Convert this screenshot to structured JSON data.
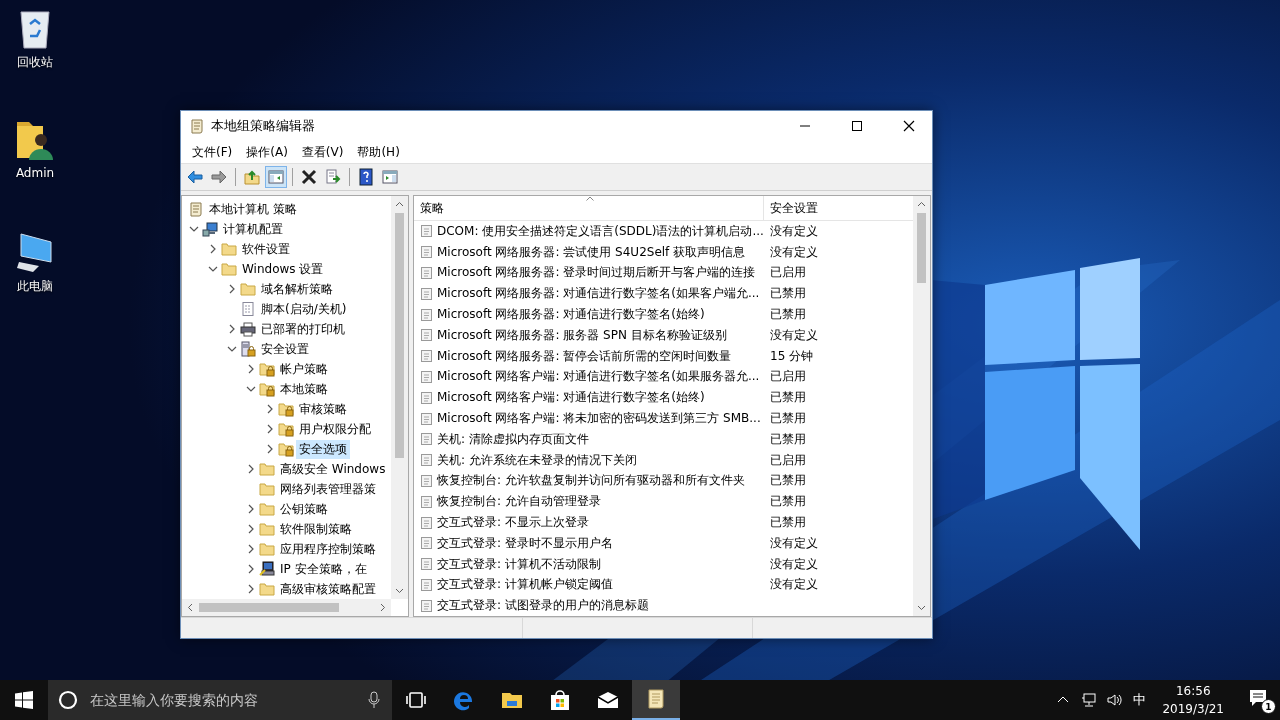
{
  "desktop_icons": [
    {
      "label": "回收站",
      "kind": "recycle"
    },
    {
      "label": "Admin",
      "kind": "user"
    },
    {
      "label": "此电脑",
      "kind": "pc"
    }
  ],
  "window": {
    "title": "本地组策略编辑器"
  },
  "menu": [
    "文件(F)",
    "操作(A)",
    "查看(V)",
    "帮助(H)"
  ],
  "toolbar": [
    {
      "kind": "back",
      "pressed": false
    },
    {
      "kind": "forward",
      "pressed": false
    },
    {
      "kind": "separator"
    },
    {
      "kind": "up",
      "pressed": false
    },
    {
      "kind": "tree-toggle",
      "pressed": true
    },
    {
      "kind": "separator"
    },
    {
      "kind": "delete",
      "pressed": false
    },
    {
      "kind": "export",
      "pressed": false
    },
    {
      "kind": "separator"
    },
    {
      "kind": "help",
      "pressed": false
    },
    {
      "kind": "view",
      "pressed": false
    }
  ],
  "tree": [
    {
      "label": "本地计算机 策略",
      "kind": "doc",
      "selected": false,
      "children": [
        {
          "label": "计算机配置",
          "kind": "computer",
          "expanded": true,
          "selected": false,
          "children": [
            {
              "label": "软件设置",
              "kind": "folder",
              "expanded": false,
              "selected": false
            },
            {
              "label": "Windows 设置",
              "kind": "folder",
              "expanded": true,
              "selected": false,
              "children": [
                {
                  "label": "域名解析策略",
                  "kind": "folder",
                  "expanded": false,
                  "selected": false
                },
                {
                  "label": "脚本(启动/关机)",
                  "kind": "script",
                  "selected": false
                },
                {
                  "label": "已部署的打印机",
                  "kind": "printer",
                  "expanded": false,
                  "selected": false
                },
                {
                  "label": "安全设置",
                  "kind": "server",
                  "expanded": true,
                  "selected": false,
                  "children": [
                    {
                      "label": "帐户策略",
                      "kind": "lock-folder",
                      "expanded": false,
                      "selected": false
                    },
                    {
                      "label": "本地策略",
                      "kind": "lock-folder",
                      "expanded": true,
                      "selected": false,
                      "children": [
                        {
                          "label": "审核策略",
                          "kind": "lock-folder",
                          "expanded": false,
                          "selected": false
                        },
                        {
                          "label": "用户权限分配",
                          "kind": "lock-folder",
                          "expanded": false,
                          "selected": false
                        },
                        {
                          "label": "安全选项",
                          "kind": "lock-folder",
                          "expanded": false,
                          "selected": true
                        }
                      ]
                    },
                    {
                      "label": "高级安全 Windows",
                      "kind": "folder",
                      "expanded": false,
                      "selected": false
                    },
                    {
                      "label": "网络列表管理器策",
                      "kind": "folder",
                      "selected": false
                    },
                    {
                      "label": "公钥策略",
                      "kind": "folder",
                      "expanded": false,
                      "selected": false
                    },
                    {
                      "label": "软件限制策略",
                      "kind": "folder",
                      "expanded": false,
                      "selected": false
                    },
                    {
                      "label": "应用程序控制策略",
                      "kind": "folder",
                      "expanded": false,
                      "selected": false
                    },
                    {
                      "label": "IP 安全策略，在",
                      "kind": "ip",
                      "expanded": false,
                      "selected": false
                    },
                    {
                      "label": "高级审核策略配置",
                      "kind": "folder",
                      "expanded": false,
                      "selected": false
                    }
                  ]
                }
              ]
            }
          ]
        }
      ]
    }
  ],
  "list": {
    "columns": [
      "策略",
      "安全设置"
    ],
    "rows": [
      {
        "policy": "DCOM: 使用安全描述符定义语言(SDDL)语法的计算机启动...",
        "setting": "没有定义"
      },
      {
        "policy": "Microsoft 网络服务器: 尝试使用 S4U2Self 获取声明信息",
        "setting": "没有定义"
      },
      {
        "policy": "Microsoft 网络服务器: 登录时间过期后断开与客户端的连接",
        "setting": "已启用"
      },
      {
        "policy": "Microsoft 网络服务器: 对通信进行数字签名(如果客户端允...",
        "setting": "已禁用"
      },
      {
        "policy": "Microsoft 网络服务器: 对通信进行数字签名(始终)",
        "setting": "已禁用"
      },
      {
        "policy": "Microsoft 网络服务器: 服务器 SPN 目标名称验证级别",
        "setting": "没有定义"
      },
      {
        "policy": "Microsoft 网络服务器: 暂停会话前所需的空闲时间数量",
        "setting": "15 分钟"
      },
      {
        "policy": "Microsoft 网络客户端: 对通信进行数字签名(如果服务器允...",
        "setting": "已启用"
      },
      {
        "policy": "Microsoft 网络客户端: 对通信进行数字签名(始终)",
        "setting": "已禁用"
      },
      {
        "policy": "Microsoft 网络客户端: 将未加密的密码发送到第三方 SMB...",
        "setting": "已禁用"
      },
      {
        "policy": "关机: 清除虚拟内存页面文件",
        "setting": "已禁用"
      },
      {
        "policy": "关机: 允许系统在未登录的情况下关闭",
        "setting": "已启用"
      },
      {
        "policy": "恢复控制台: 允许软盘复制并访问所有驱动器和所有文件夹",
        "setting": "已禁用"
      },
      {
        "policy": "恢复控制台: 允许自动管理登录",
        "setting": "已禁用"
      },
      {
        "policy": "交互式登录: 不显示上次登录",
        "setting": "已禁用"
      },
      {
        "policy": "交互式登录: 登录时不显示用户名",
        "setting": "没有定义"
      },
      {
        "policy": "交互式登录: 计算机不活动限制",
        "setting": "没有定义"
      },
      {
        "policy": "交互式登录: 计算机帐户锁定阈值",
        "setting": "没有定义"
      },
      {
        "policy": "交互式登录: 试图登录的用户的消息标题"
      }
    ]
  },
  "taskbar": {
    "search": {
      "placeholder": "在这里输入你要搜索的内容"
    },
    "apps": [
      {
        "kind": "task-view",
        "active": false
      },
      {
        "kind": "edge",
        "active": false
      },
      {
        "kind": "explorer",
        "active": false
      },
      {
        "kind": "store",
        "active": false
      },
      {
        "kind": "mail",
        "active": false
      },
      {
        "kind": "gpedit",
        "active": true
      }
    ],
    "ime": "中",
    "time": "16:56",
    "date": "2019/3/21",
    "notifications": "1"
  }
}
